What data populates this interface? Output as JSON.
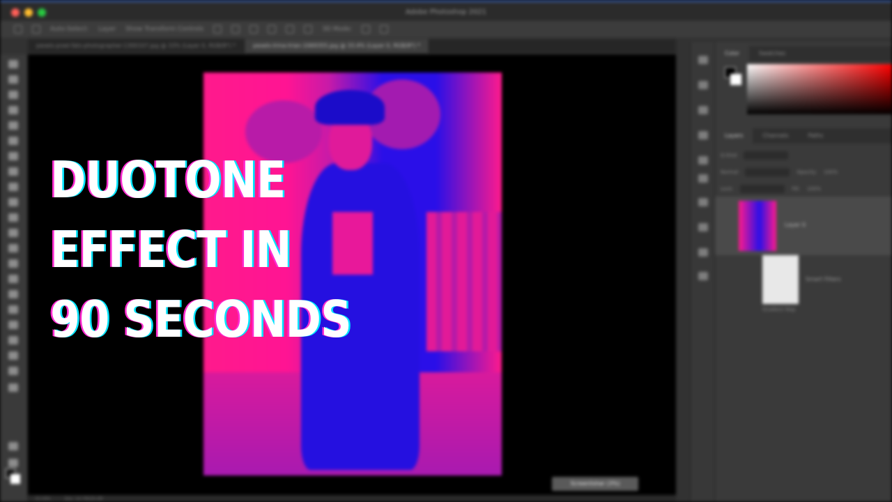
{
  "window": {
    "title": "Adobe Photoshop 2021"
  },
  "options_bar": {
    "auto_select_label": "Auto-Select:",
    "auto_select_value": "Layer",
    "transform_controls_label": "Show Transform Controls",
    "mode_label": "3D Mode:"
  },
  "document_tabs": [
    {
      "label": "pexels-pixel-fats-photographer-1300107.jpg @ 33% (Layer 0, RGB/8*) *"
    },
    {
      "label": "pexels-trina-trian-1069355.jpg @ 33.4% (Layer 0, RGB/8*) *"
    }
  ],
  "canvas": {
    "tooltip": "Screenlisher (3%)"
  },
  "status_bar": {
    "zoom": "33.34%",
    "doc_info": "Doc: 14.7M/29.4M"
  },
  "color_panel": {
    "tabs": [
      "Color",
      "Swatches"
    ]
  },
  "layers_panel": {
    "tabs": [
      "Layers",
      "Channels",
      "Paths"
    ],
    "kind_label": "Q Kind",
    "blend_mode": "Normal",
    "opacity_label": "Opacity:",
    "opacity_value": "100%",
    "lock_label": "Lock:",
    "fill_label": "Fill:",
    "fill_value": "100%",
    "layers": [
      {
        "name": "Layer 0"
      },
      {
        "name": "Smart Filters"
      },
      {
        "name": "Gradient Map"
      }
    ]
  },
  "headline": {
    "line1": "DUOTONE",
    "line2": "EFFECT IN",
    "line3": "90 SECONDS",
    "color": "#ffffff",
    "shadow_cyan": "#00e5ff",
    "shadow_magenta": "#ff2bd1"
  },
  "duotone": {
    "color_a": "#ff1a8c",
    "color_b": "#2a0fe8"
  }
}
